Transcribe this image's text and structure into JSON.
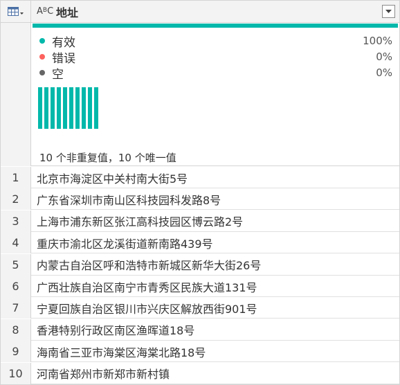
{
  "header": {
    "type_badge_big": "A",
    "type_badge_small": "B",
    "type_badge_tail": "C",
    "column_title": "地址"
  },
  "profile": {
    "valid_label": "有效",
    "valid_value": "100%",
    "error_label": "错误",
    "error_value": "0%",
    "empty_label": "空",
    "empty_value": "0%",
    "distinct_text": "10 个非重复值，10 个唯一值",
    "distribution": [
      1,
      1,
      1,
      1,
      1,
      1,
      1,
      1,
      1,
      1
    ],
    "colors": {
      "valid": "#01b8aa",
      "error": "#fd625e",
      "empty": "#666666",
      "bars": "#01b8aa"
    }
  },
  "rows": [
    {
      "num": "1",
      "value": "北京市海淀区中关村南大街5号"
    },
    {
      "num": "2",
      "value": "广东省深圳市南山区科技园科发路8号"
    },
    {
      "num": "3",
      "value": "上海市浦东新区张江高科技园区博云路2号"
    },
    {
      "num": "4",
      "value": "重庆市渝北区龙溪街道新南路439号"
    },
    {
      "num": "5",
      "value": "内蒙古自治区呼和浩特市新城区新华大街26号"
    },
    {
      "num": "6",
      "value": "广西壮族自治区南宁市青秀区民族大道131号"
    },
    {
      "num": "7",
      "value": "宁夏回族自治区银川市兴庆区解放西街901号"
    },
    {
      "num": "8",
      "value": "香港特别行政区南区渔晖道18号"
    },
    {
      "num": "9",
      "value": "海南省三亚市海棠区海棠北路18号"
    },
    {
      "num": "10",
      "value": "河南省郑州市新郑市新村镇"
    }
  ]
}
